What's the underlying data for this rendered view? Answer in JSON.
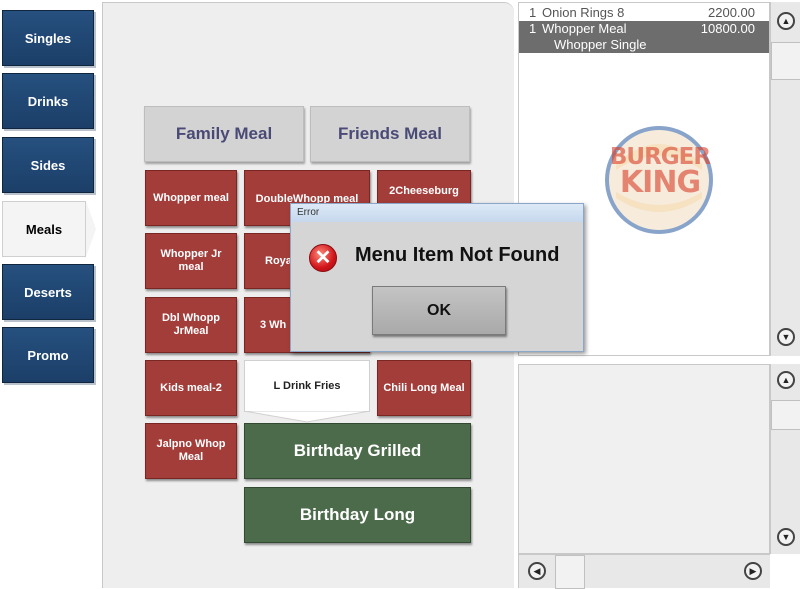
{
  "categories": {
    "items": [
      {
        "label": "Singles"
      },
      {
        "label": "Drinks"
      },
      {
        "label": "Sides"
      },
      {
        "label": "Meals",
        "selected": true
      },
      {
        "label": "Deserts"
      },
      {
        "label": "Promo"
      }
    ]
  },
  "menu": {
    "family_meal": "Family Meal",
    "friends_meal": "Friends Meal",
    "whopper_meal": "Whopper meal",
    "double_whopp_meal": "DoubleWhopp meal",
    "two_cheeseburg": "2Cheeseburg",
    "whopper_jr_meal": "Whopper Jr meal",
    "roya": "Roya",
    "dbl_whopp_jrmeal": "Dbl Whopp JrMeal",
    "three_wh": "3 Wh",
    "kids_meal_2": "Kids meal-2",
    "l_drink_fries": "L Drink Fries",
    "chili_long_meal": "Chili Long Meal",
    "jalpno_whop_meal": "Jalpno Whop Meal",
    "birthday_grilled": "Birthday Grilled",
    "birthday_long": "Birthday Long"
  },
  "order": {
    "rows": [
      {
        "qty": "1",
        "name": "Onion Rings 8",
        "price": "2200.00"
      },
      {
        "qty": "1",
        "name": "Whopper Meal",
        "price": "10800.00",
        "selected": true
      },
      {
        "qty": "",
        "name": "Whopper Single",
        "price": ""
      }
    ]
  },
  "logo": {
    "line1": "BURGER",
    "line2": "KING"
  },
  "dialog": {
    "title": "Error",
    "message": "Menu Item Not Found",
    "ok_label": "OK",
    "icon": "error-x-icon"
  },
  "colors": {
    "category_blue": "#1f4672",
    "meal_red": "#a33d3a",
    "promo_green": "#4b6b4a",
    "logo_red": "#d8402a",
    "logo_blue": "#2a5aa0"
  }
}
